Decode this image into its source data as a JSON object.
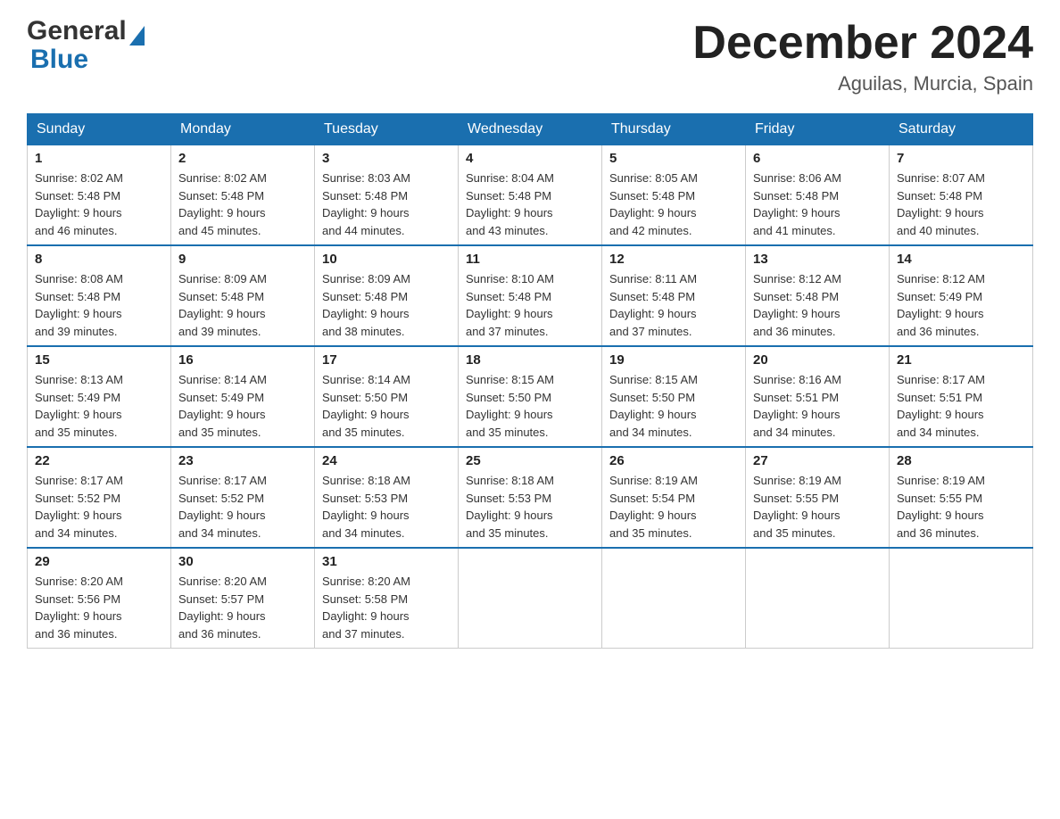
{
  "header": {
    "logo": {
      "text_general": "General",
      "text_blue": "Blue",
      "alt": "GeneralBlue logo"
    },
    "title": "December 2024",
    "location": "Aguilas, Murcia, Spain"
  },
  "calendar": {
    "days_of_week": [
      "Sunday",
      "Monday",
      "Tuesday",
      "Wednesday",
      "Thursday",
      "Friday",
      "Saturday"
    ],
    "weeks": [
      [
        {
          "day": "1",
          "sunrise": "8:02 AM",
          "sunset": "5:48 PM",
          "daylight": "9 hours and 46 minutes."
        },
        {
          "day": "2",
          "sunrise": "8:02 AM",
          "sunset": "5:48 PM",
          "daylight": "9 hours and 45 minutes."
        },
        {
          "day": "3",
          "sunrise": "8:03 AM",
          "sunset": "5:48 PM",
          "daylight": "9 hours and 44 minutes."
        },
        {
          "day": "4",
          "sunrise": "8:04 AM",
          "sunset": "5:48 PM",
          "daylight": "9 hours and 43 minutes."
        },
        {
          "day": "5",
          "sunrise": "8:05 AM",
          "sunset": "5:48 PM",
          "daylight": "9 hours and 42 minutes."
        },
        {
          "day": "6",
          "sunrise": "8:06 AM",
          "sunset": "5:48 PM",
          "daylight": "9 hours and 41 minutes."
        },
        {
          "day": "7",
          "sunrise": "8:07 AM",
          "sunset": "5:48 PM",
          "daylight": "9 hours and 40 minutes."
        }
      ],
      [
        {
          "day": "8",
          "sunrise": "8:08 AM",
          "sunset": "5:48 PM",
          "daylight": "9 hours and 39 minutes."
        },
        {
          "day": "9",
          "sunrise": "8:09 AM",
          "sunset": "5:48 PM",
          "daylight": "9 hours and 39 minutes."
        },
        {
          "day": "10",
          "sunrise": "8:09 AM",
          "sunset": "5:48 PM",
          "daylight": "9 hours and 38 minutes."
        },
        {
          "day": "11",
          "sunrise": "8:10 AM",
          "sunset": "5:48 PM",
          "daylight": "9 hours and 37 minutes."
        },
        {
          "day": "12",
          "sunrise": "8:11 AM",
          "sunset": "5:48 PM",
          "daylight": "9 hours and 37 minutes."
        },
        {
          "day": "13",
          "sunrise": "8:12 AM",
          "sunset": "5:48 PM",
          "daylight": "9 hours and 36 minutes."
        },
        {
          "day": "14",
          "sunrise": "8:12 AM",
          "sunset": "5:49 PM",
          "daylight": "9 hours and 36 minutes."
        }
      ],
      [
        {
          "day": "15",
          "sunrise": "8:13 AM",
          "sunset": "5:49 PM",
          "daylight": "9 hours and 35 minutes."
        },
        {
          "day": "16",
          "sunrise": "8:14 AM",
          "sunset": "5:49 PM",
          "daylight": "9 hours and 35 minutes."
        },
        {
          "day": "17",
          "sunrise": "8:14 AM",
          "sunset": "5:50 PM",
          "daylight": "9 hours and 35 minutes."
        },
        {
          "day": "18",
          "sunrise": "8:15 AM",
          "sunset": "5:50 PM",
          "daylight": "9 hours and 35 minutes."
        },
        {
          "day": "19",
          "sunrise": "8:15 AM",
          "sunset": "5:50 PM",
          "daylight": "9 hours and 34 minutes."
        },
        {
          "day": "20",
          "sunrise": "8:16 AM",
          "sunset": "5:51 PM",
          "daylight": "9 hours and 34 minutes."
        },
        {
          "day": "21",
          "sunrise": "8:17 AM",
          "sunset": "5:51 PM",
          "daylight": "9 hours and 34 minutes."
        }
      ],
      [
        {
          "day": "22",
          "sunrise": "8:17 AM",
          "sunset": "5:52 PM",
          "daylight": "9 hours and 34 minutes."
        },
        {
          "day": "23",
          "sunrise": "8:17 AM",
          "sunset": "5:52 PM",
          "daylight": "9 hours and 34 minutes."
        },
        {
          "day": "24",
          "sunrise": "8:18 AM",
          "sunset": "5:53 PM",
          "daylight": "9 hours and 34 minutes."
        },
        {
          "day": "25",
          "sunrise": "8:18 AM",
          "sunset": "5:53 PM",
          "daylight": "9 hours and 35 minutes."
        },
        {
          "day": "26",
          "sunrise": "8:19 AM",
          "sunset": "5:54 PM",
          "daylight": "9 hours and 35 minutes."
        },
        {
          "day": "27",
          "sunrise": "8:19 AM",
          "sunset": "5:55 PM",
          "daylight": "9 hours and 35 minutes."
        },
        {
          "day": "28",
          "sunrise": "8:19 AM",
          "sunset": "5:55 PM",
          "daylight": "9 hours and 36 minutes."
        }
      ],
      [
        {
          "day": "29",
          "sunrise": "8:20 AM",
          "sunset": "5:56 PM",
          "daylight": "9 hours and 36 minutes."
        },
        {
          "day": "30",
          "sunrise": "8:20 AM",
          "sunset": "5:57 PM",
          "daylight": "9 hours and 36 minutes."
        },
        {
          "day": "31",
          "sunrise": "8:20 AM",
          "sunset": "5:58 PM",
          "daylight": "9 hours and 37 minutes."
        },
        null,
        null,
        null,
        null
      ]
    ],
    "labels": {
      "sunrise": "Sunrise:",
      "sunset": "Sunset:",
      "daylight": "Daylight:"
    }
  }
}
